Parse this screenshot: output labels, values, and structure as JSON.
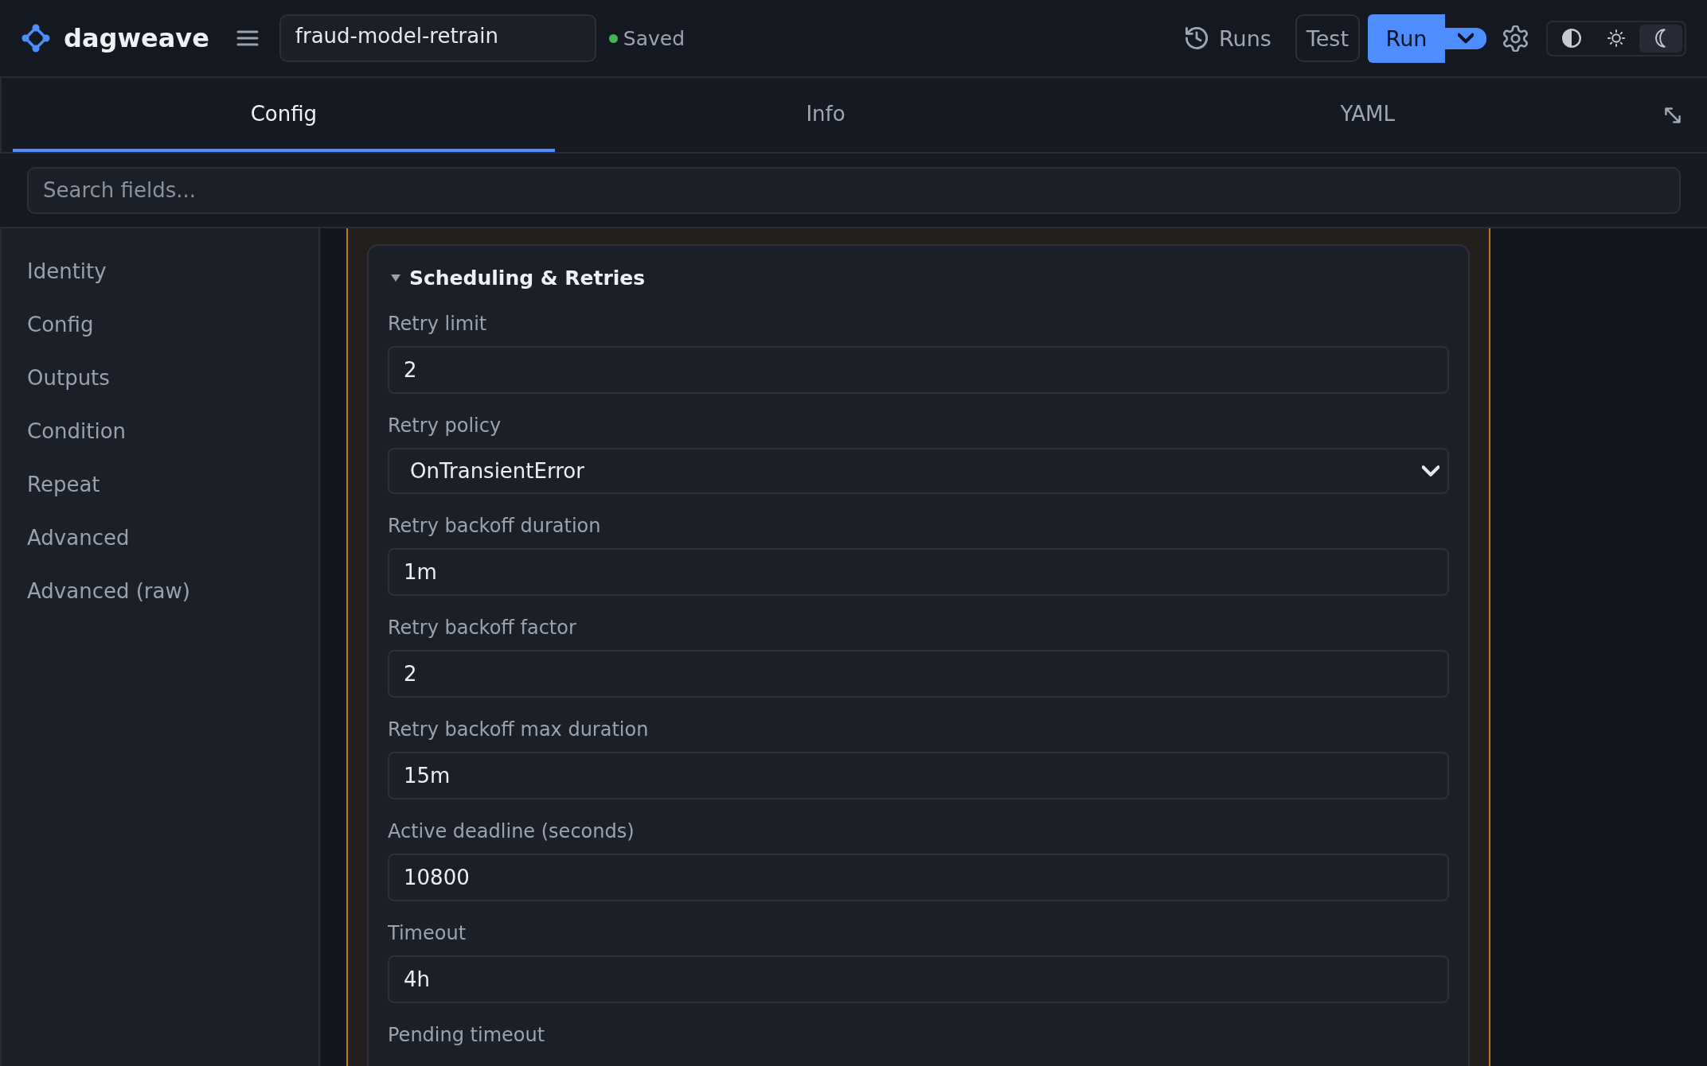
{
  "header": {
    "brand": "dagweave",
    "workflow_name": "fraud-model-retrain",
    "save_status": "Saved",
    "actions": {
      "runs": "Runs",
      "test": "Test",
      "run": "Run"
    },
    "theme_modes": [
      {
        "kind": "auto",
        "selected": false
      },
      {
        "kind": "light",
        "selected": false
      },
      {
        "kind": "dark",
        "selected": true
      }
    ]
  },
  "tabs": [
    {
      "label": "Config",
      "selected": true
    },
    {
      "label": "Info",
      "selected": false
    },
    {
      "label": "YAML",
      "selected": false
    }
  ],
  "search": {
    "placeholder": "Search fields..."
  },
  "sidebar": {
    "items": [
      {
        "label": "Identity",
        "selected": false
      },
      {
        "label": "Config",
        "selected": false
      },
      {
        "label": "Outputs",
        "selected": false
      },
      {
        "label": "Condition",
        "selected": false
      },
      {
        "label": "Repeat",
        "selected": false
      },
      {
        "label": "Advanced",
        "selected": false
      },
      {
        "label": "Advanced (raw)",
        "selected": false
      }
    ]
  },
  "section": {
    "title": "Scheduling & Retries",
    "expanded": true,
    "fields": [
      {
        "kind": "input",
        "label": "Retry limit",
        "value": "2"
      },
      {
        "kind": "select",
        "label": "Retry policy",
        "value": "OnTransientError"
      },
      {
        "kind": "input",
        "label": "Retry backoff duration",
        "value": "1m"
      },
      {
        "kind": "input",
        "label": "Retry backoff factor",
        "value": "2"
      },
      {
        "kind": "input",
        "label": "Retry backoff max duration",
        "value": "15m"
      },
      {
        "kind": "input",
        "label": "Active deadline (seconds)",
        "value": "10800"
      },
      {
        "kind": "input",
        "label": "Timeout",
        "value": "4h"
      },
      {
        "kind": "label-only",
        "label": "Pending timeout"
      }
    ]
  }
}
